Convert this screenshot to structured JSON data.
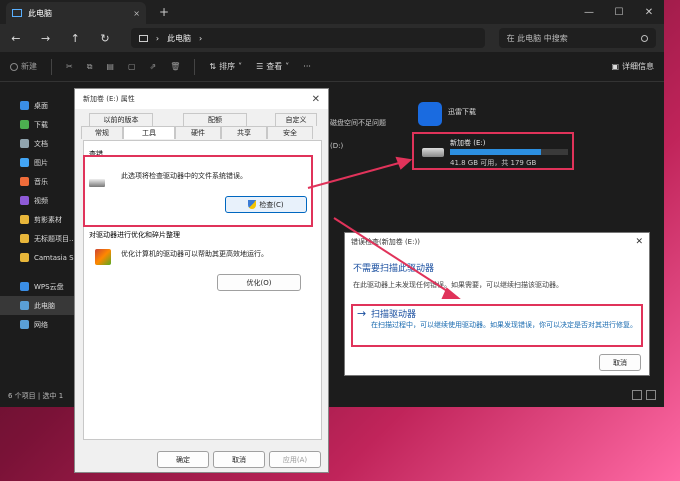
{
  "window": {
    "tab_title": "此电脑",
    "tab_close": "×",
    "tab_new": "+",
    "minimize": "—",
    "maximize": "☐",
    "close": "✕"
  },
  "nav": {
    "back": "←",
    "forward": "→",
    "up": "↑",
    "refresh": "↻",
    "breadcrumb_sep": "›",
    "breadcrumb_item": "此电脑",
    "search_placeholder": "在 此电脑 中搜索"
  },
  "toolbar": {
    "new_label": "新建",
    "sort_label": "排序",
    "view_label": "查看",
    "more_label": "···",
    "details_label": "详细信息"
  },
  "sidebar": {
    "items": [
      {
        "label": "桌面",
        "color": "#3a8ee6"
      },
      {
        "label": "下载",
        "color": "#4caf50"
      },
      {
        "label": "文档",
        "color": "#90a4ae"
      },
      {
        "label": "图片",
        "color": "#42a5f5"
      },
      {
        "label": "音乐",
        "color": "#ef6c3a"
      },
      {
        "label": "视频",
        "color": "#8e5ad7"
      },
      {
        "label": "剪影素材",
        "color": "#e8b63a"
      },
      {
        "label": "无标题项目...",
        "color": "#e8b63a"
      },
      {
        "label": "Camtasia S",
        "color": "#e8b63a"
      }
    ],
    "group_items": [
      {
        "label": "WPS云盘",
        "color": "#3a8ee6"
      },
      {
        "label": "此电脑",
        "color": "#5a9fd6"
      },
      {
        "label": "网络",
        "color": "#5a9fd6"
      }
    ]
  },
  "status": {
    "text": "6 个项目  |  选中 1"
  },
  "drive_area": {
    "thunder_label": "迅雷下载",
    "hint_space": "磁盘空间不足问题",
    "hint_drive": "(D:)",
    "drive_name": "新加卷 (E:)",
    "drive_size": "41.8 GB 可用，共 179 GB",
    "used_fraction": 0.77
  },
  "properties": {
    "title": "新加卷 (E:) 属性",
    "close": "✕",
    "tabs_row1": [
      "以前的版本",
      "配额",
      "自定义"
    ],
    "tabs_row2": [
      "常规",
      "工具",
      "硬件",
      "共享",
      "安全"
    ],
    "active_tab": "工具",
    "check_group": "查错",
    "check_desc": "此选项将检查驱动器中的文件系统错误。",
    "check_button": "检查(C)",
    "opt_group": "对驱动器进行优化和碎片整理",
    "opt_desc": "优化计算机的驱动器可以帮助其更高效地运行。",
    "opt_button": "优化(O)",
    "ok_button": "确定",
    "cancel_button": "取消",
    "apply_button": "应用(A)"
  },
  "error_check": {
    "title": "错误检查(新加卷 (E:))",
    "close": "✕",
    "heading": "不需要扫描此驱动器",
    "subtext": "在此驱动器上未发现任何错误。如果需要，可以继续扫描该驱动器。",
    "scan_arrow": "→",
    "scan_title": "扫描驱动器",
    "scan_desc": "在扫描过程中，可以继续使用驱动器。如果发现错误，你可以决定是否对其进行修复。",
    "cancel_button": "取消"
  },
  "colors": {
    "highlight": "#e0335a",
    "accent_blue": "#1a4fa0"
  }
}
